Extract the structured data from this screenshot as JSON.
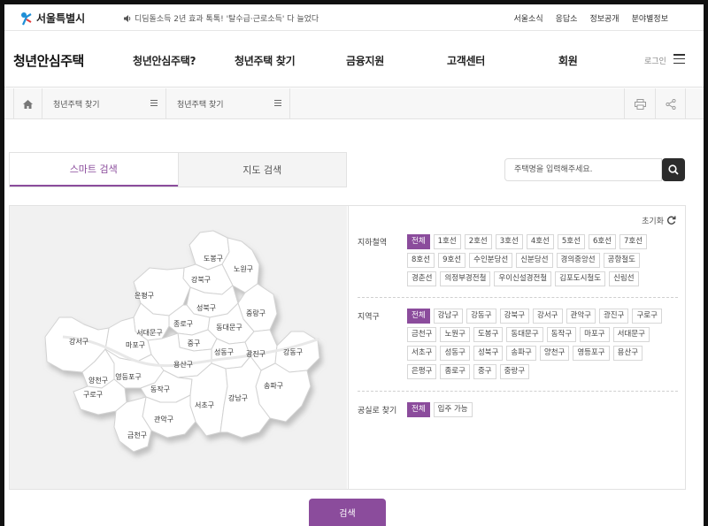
{
  "header": {
    "logo_text": "서울특별시",
    "notice": "디딤돌소득 2년 효과 톡톡! '탈수급·근로소득' 다 늘었다",
    "util_links": [
      "서울소식",
      "응답소",
      "정보공개",
      "분야별정보"
    ]
  },
  "nav": {
    "site_title": "청년안심주택",
    "items": [
      "청년안심주택?",
      "청년주택 찾기",
      "금융지원",
      "고객센터",
      "회원"
    ],
    "login": "로그인"
  },
  "breadcrumb": [
    "청년주택 찾기",
    "청년주택 찾기"
  ],
  "tabs": [
    "스마트 검색",
    "지도 검색"
  ],
  "search": {
    "placeholder": "주택명을 입력해주세요."
  },
  "map": {
    "districts": [
      "도봉구",
      "노원구",
      "강북구",
      "은평구",
      "성북구",
      "중랑구",
      "종로구",
      "서대문구",
      "동대문구",
      "마포구",
      "중구",
      "강서구",
      "성동구",
      "광진구",
      "강동구",
      "용산구",
      "양천구",
      "영등포구",
      "동작구",
      "구로구",
      "송파구",
      "서초구",
      "강남구",
      "관악구",
      "금천구"
    ]
  },
  "filters": {
    "reset_label": "초기화",
    "subway": {
      "label": "지하철역",
      "options": [
        "전체",
        "1호선",
        "2호선",
        "3호선",
        "4호선",
        "5호선",
        "6호선",
        "7호선",
        "8호선",
        "9호선",
        "수인분당선",
        "신분당선",
        "경의중앙선",
        "공항철도",
        "경춘선",
        "의정부경전철",
        "우이신설경전철",
        "김포도시철도",
        "신림선"
      ],
      "selected": "전체"
    },
    "district": {
      "label": "지역구",
      "options": [
        "전체",
        "강남구",
        "강동구",
        "강북구",
        "강서구",
        "관악구",
        "광진구",
        "구로구",
        "금천구",
        "노원구",
        "도봉구",
        "동대문구",
        "동작구",
        "마포구",
        "서대문구",
        "서초구",
        "성동구",
        "성북구",
        "송파구",
        "양천구",
        "영등포구",
        "용산구",
        "은평구",
        "종로구",
        "중구",
        "중랑구"
      ],
      "selected": "전체"
    },
    "vacancy": {
      "label": "공실로 찾기",
      "options": [
        "전체",
        "입주 가능"
      ],
      "selected": "전체"
    }
  },
  "submit_label": "검색",
  "colors": {
    "accent": "#8b4c9c"
  }
}
